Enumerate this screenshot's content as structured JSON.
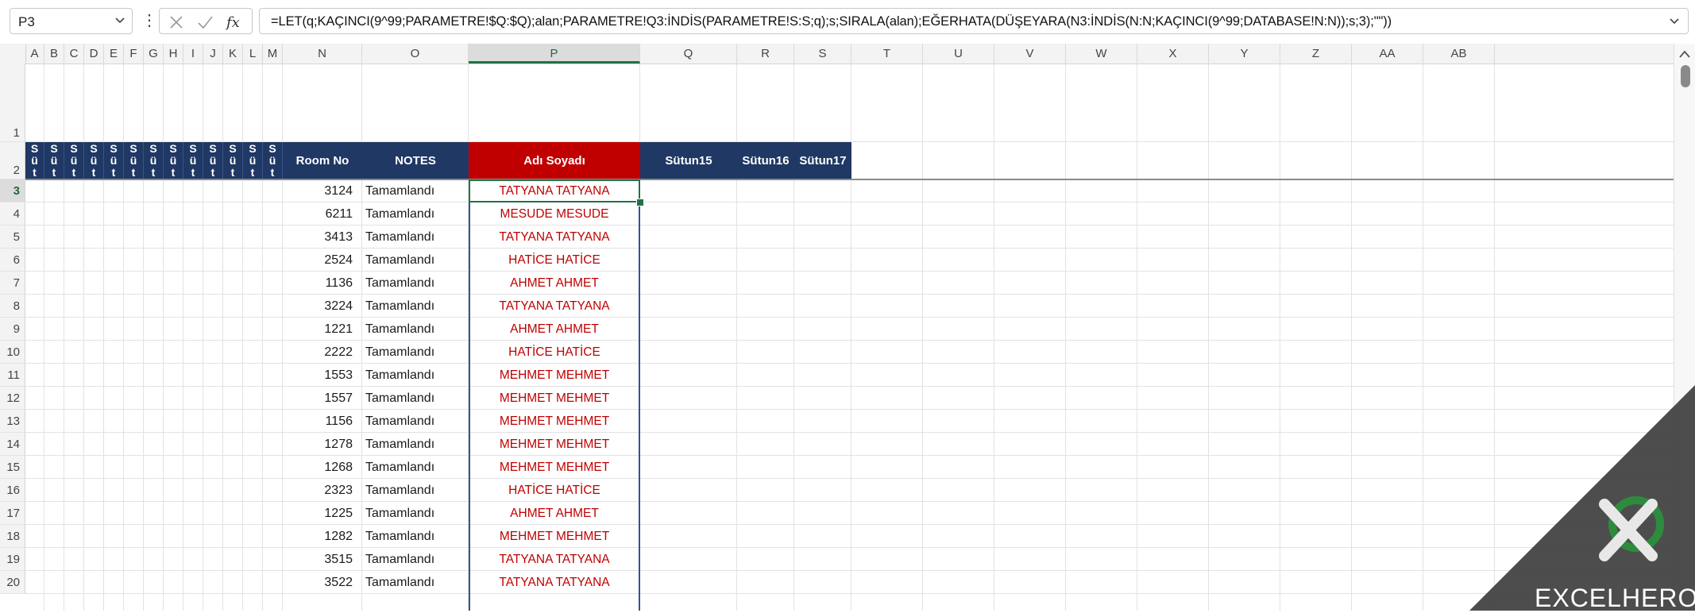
{
  "formula_bar": {
    "name_box": "P3",
    "cancel_icon": "x-icon",
    "enter_icon": "check-icon",
    "function_icon": "fx-icon",
    "formula": "=LET(q;KAÇINCI(9^99;PARAMETRE!$Q:$Q);alan;PARAMETRE!Q3:İNDİS(PARAMETRE!S:S;q);s;SIRALA(alan);EĞERHATA(DÜŞEYARA(N3:İNDİS(N:N;KAÇINCI(9^99;DATABASE!N:N));s;3);\"\"))"
  },
  "columns": [
    "A",
    "B",
    "C",
    "D",
    "E",
    "F",
    "G",
    "H",
    "I",
    "J",
    "K",
    "L",
    "M",
    "N",
    "O",
    "P",
    "Q",
    "R",
    "S",
    "T",
    "U",
    "V",
    "W",
    "X",
    "Y",
    "Z",
    "AA",
    "AB"
  ],
  "selected_column": "P",
  "rows": [
    "1",
    "2",
    "3",
    "4",
    "5",
    "6",
    "7",
    "8",
    "9",
    "10",
    "11",
    "12",
    "13",
    "14",
    "15",
    "16",
    "17",
    "18",
    "19",
    "20"
  ],
  "selected_row": "3",
  "table_header": {
    "narrow": [
      "Sütu",
      "Sütu",
      "Sütu",
      "Sütu",
      "Sütu",
      "Sütu",
      "Sütu",
      "Sütu",
      "Sütu",
      "Sütu",
      "Sütu",
      "Sütu",
      "Sütu"
    ],
    "room_no": "Room No",
    "notes": "NOTES",
    "name": "Adı Soyadı",
    "col15": "Sütun15",
    "col16": "Sütun16",
    "col17": "Sütun17"
  },
  "table_rows": [
    {
      "room": "3124",
      "note": "Tamamlandı",
      "name": "TATYANA TATYANA"
    },
    {
      "room": "6211",
      "note": "Tamamlandı",
      "name": "MESUDE MESUDE"
    },
    {
      "room": "3413",
      "note": "Tamamlandı",
      "name": "TATYANA TATYANA"
    },
    {
      "room": "2524",
      "note": "Tamamlandı",
      "name": "HATİCE HATİCE"
    },
    {
      "room": "1136",
      "note": "Tamamlandı",
      "name": "AHMET AHMET"
    },
    {
      "room": "3224",
      "note": "Tamamlandı",
      "name": "TATYANA TATYANA"
    },
    {
      "room": "1221",
      "note": "Tamamlandı",
      "name": "AHMET AHMET"
    },
    {
      "room": "2222",
      "note": "Tamamlandı",
      "name": "HATİCE HATİCE"
    },
    {
      "room": "1553",
      "note": "Tamamlandı",
      "name": "MEHMET MEHMET"
    },
    {
      "room": "1557",
      "note": "Tamamlandı",
      "name": "MEHMET MEHMET"
    },
    {
      "room": "1156",
      "note": "Tamamlandı",
      "name": "MEHMET MEHMET"
    },
    {
      "room": "1278",
      "note": "Tamamlandı",
      "name": "MEHMET MEHMET"
    },
    {
      "room": "1268",
      "note": "Tamamlandı",
      "name": "MEHMET MEHMET"
    },
    {
      "room": "2323",
      "note": "Tamamlandı",
      "name": "HATİCE HATİCE"
    },
    {
      "room": "1225",
      "note": "Tamamlandı",
      "name": "AHMET AHMET"
    },
    {
      "room": "1282",
      "note": "Tamamlandı",
      "name": "MEHMET MEHMET"
    },
    {
      "room": "3515",
      "note": "Tamamlandı",
      "name": "TATYANA TATYANA"
    },
    {
      "room": "3522",
      "note": "Tamamlandı",
      "name": "TATYANA TATYANA"
    }
  ],
  "colors": {
    "header_navy": "#1f3864",
    "header_red": "#c00000",
    "name_text": "#c00000",
    "selection_green": "#217346",
    "column_p_border": "#2f5597"
  },
  "watermark": {
    "logo_icon": "excel-hero-logo-icon",
    "text": "EXCELHERO"
  }
}
